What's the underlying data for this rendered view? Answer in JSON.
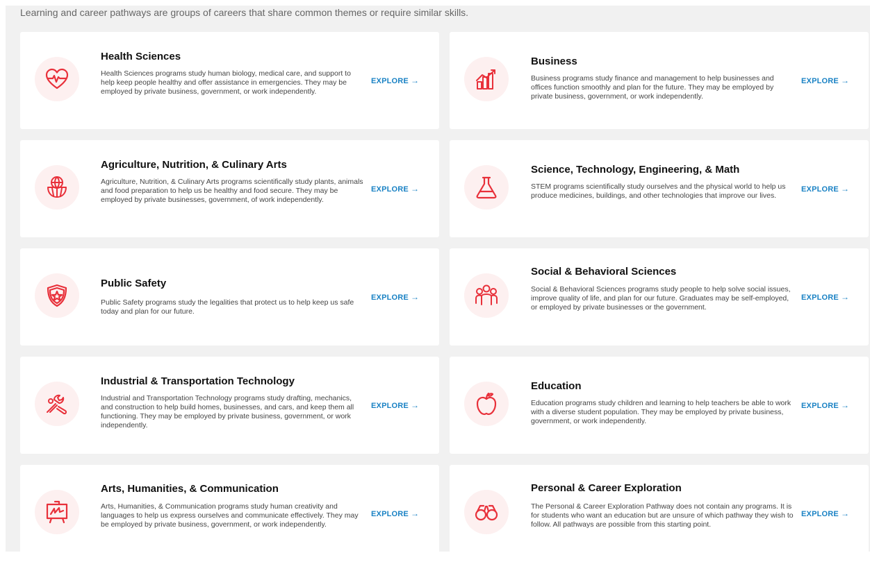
{
  "intro": "Learning and career pathways are groups of careers that share common themes or require similar skills.",
  "explore_label": "EXPLORE",
  "explore_arrow": "→",
  "accent_color": "#e8303a",
  "link_color": "#1a82c4",
  "pathways": [
    {
      "title": "Health Sciences",
      "icon": "heart-pulse-icon",
      "description": "Health Sciences programs study human biology, medical care, and support to help keep people healthy and offer assistance in emergencies. They may be employed by private business, government, or work independently."
    },
    {
      "title": "Business",
      "icon": "chart-graph-icon",
      "description": "Business programs study finance and management to help businesses and offices function smoothly and plan for the future. They may be employed by private business, government, or work independently."
    },
    {
      "title": "Agriculture, Nutrition, & Culinary Arts",
      "icon": "globe-basket-icon",
      "description": "Agriculture, Nutrition, & Culinary Arts programs scientifically study plants, animals and food preparation to help us be healthy and food secure. They may be employed by private businesses, government, of work independently."
    },
    {
      "title": "Science, Technology, Engineering, & Math",
      "icon": "flask-icon",
      "description": "STEM programs scientifically study ourselves and the physical world to help us produce medicines, buildings, and other technologies that improve our lives."
    },
    {
      "title": "Public Safety",
      "icon": "shield-star-icon",
      "description": "Public Safety programs study the legalities that protect us to help keep us safe today and plan for our future."
    },
    {
      "title": "Social & Behavioral Sciences",
      "icon": "people-group-icon",
      "description": "Social & Behavioral Sciences programs study people to help solve social issues, improve quality of life, and plan for our future. Graduates may be self-employed, or employed by private businesses or the government."
    },
    {
      "title": "Industrial & Transportation Technology",
      "icon": "tools-icon",
      "description": "Industrial and Transportation Technology programs study drafting, mechanics, and construction to help build homes, businesses, and cars, and keep them all functioning. They may be employed by private business, government, or work independently."
    },
    {
      "title": "Education",
      "icon": "apple-icon",
      "description": "Education programs study children and learning to help teachers be able to work with a diverse student population. They may be employed by private business, government, or work independently."
    },
    {
      "title": "Arts, Humanities, & Communication",
      "icon": "easel-icon",
      "description": "Arts, Humanities, & Communication programs study human creativity and languages to help us express ourselves and communicate effectively. They may be employed by private business, government, or work independently."
    },
    {
      "title": "Personal & Career Exploration",
      "icon": "binoculars-icon",
      "description": "The Personal & Career Exploration Pathway does not contain any programs. It is for students who want an education but are unsure of which pathway they wish to follow. All pathways are possible from this starting point."
    }
  ]
}
